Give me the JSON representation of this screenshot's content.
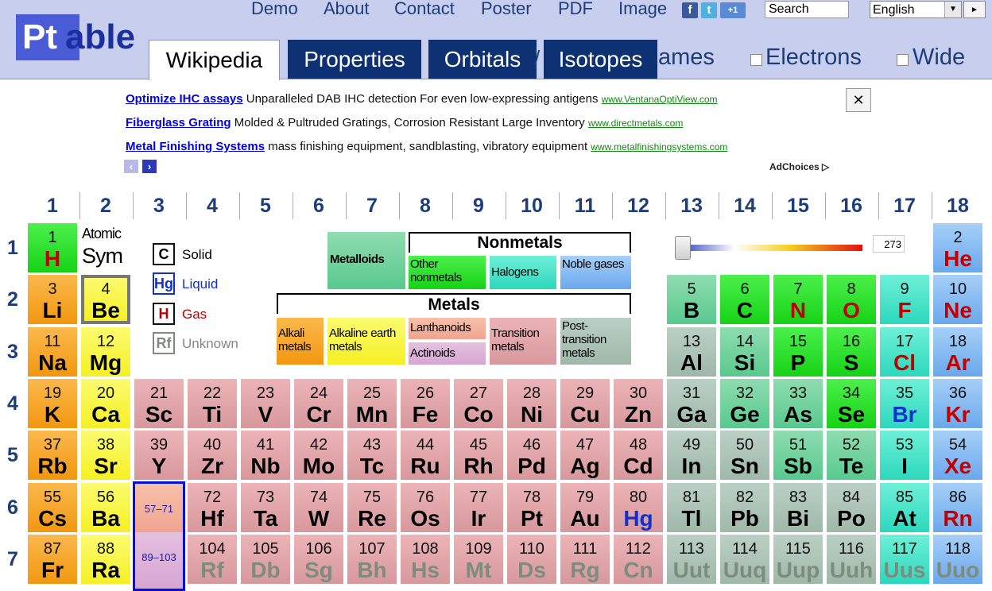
{
  "header": {
    "logo_pt": "Pt",
    "logo_able": "able",
    "nav": [
      "Demo",
      "About",
      "Contact",
      "Poster",
      "PDF",
      "Image"
    ],
    "social": [
      "f",
      "t",
      "+1"
    ],
    "search_value": "Search",
    "language": "English",
    "go_icon": "►"
  },
  "tabs": {
    "wikipedia": "Wikipedia",
    "properties": "Properties",
    "orbitals": "Orbitals",
    "isotopes": "Isotopes",
    "names_partial": "ames",
    "slash": "/",
    "electrons": "Electrons",
    "wide": "Wide"
  },
  "ads": [
    {
      "title": "Optimize IHC assays",
      "text": "Unparalleled DAB IHC detection For even low-expressing antigens",
      "url": "www.VentanaOptiView.com"
    },
    {
      "title": "Fiberglass Grating",
      "text": "Molded & Pultruded Gratings, Corrosion Resistant Large Inventory",
      "url": "www.directmetals.com"
    },
    {
      "title": "Metal Finishing Systems",
      "text": "mass finishing equipment, sandblasting, vibratory equipment",
      "url": "www.metalfinishingsystems.com"
    }
  ],
  "ad_close": "✕",
  "ad_prev": "‹",
  "ad_next": "›",
  "adchoices": "AdChoices ▷",
  "groups": [
    "1",
    "2",
    "3",
    "4",
    "5",
    "6",
    "7",
    "8",
    "9",
    "10",
    "11",
    "12",
    "13",
    "14",
    "15",
    "16",
    "17",
    "18"
  ],
  "periods": [
    "1",
    "2",
    "3",
    "4",
    "5",
    "6",
    "7"
  ],
  "legend": {
    "atomic": "Atomic",
    "sym": "Sym",
    "solid_sym": "C",
    "solid": "Solid",
    "liquid_sym": "Hg",
    "liquid": "Liquid",
    "gas_sym": "H",
    "gas": "Gas",
    "unknown_sym": "Rf",
    "unknown": "Unknown"
  },
  "categories": {
    "metalloids": "Metalloids",
    "nonmetals": "Nonmetals",
    "other_nonmetals": "Other nonmetals",
    "halogens": "Halogens",
    "noble": "Noble gases",
    "metals": "Metals",
    "alkali": "Alkali metals",
    "alkaline_earth": "Alkaline earth metals",
    "lanthanoids": "Lanthanoids",
    "actinoids": "Actinoids",
    "transition": "Transition metals",
    "post_transition": "Post-transition metals"
  },
  "temperature": "273",
  "lanthanide_range": "57–71",
  "actinide_range": "89–103",
  "elements": [
    {
      "z": "1",
      "sym": "H",
      "g": 1,
      "p": 1,
      "cat": "other",
      "state": "gas"
    },
    {
      "z": "2",
      "sym": "He",
      "g": 18,
      "p": 1,
      "cat": "noble",
      "state": "gas"
    },
    {
      "z": "3",
      "sym": "Li",
      "g": 1,
      "p": 2,
      "cat": "alkali",
      "state": "solid"
    },
    {
      "z": "4",
      "sym": "Be",
      "g": 2,
      "p": 2,
      "cat": "earth",
      "state": "solid",
      "selected": true
    },
    {
      "z": "5",
      "sym": "B",
      "g": 13,
      "p": 2,
      "cat": "metalloid",
      "state": "solid"
    },
    {
      "z": "6",
      "sym": "C",
      "g": 14,
      "p": 2,
      "cat": "other",
      "state": "solid"
    },
    {
      "z": "7",
      "sym": "N",
      "g": 15,
      "p": 2,
      "cat": "other",
      "state": "gas"
    },
    {
      "z": "8",
      "sym": "O",
      "g": 16,
      "p": 2,
      "cat": "other",
      "state": "gas"
    },
    {
      "z": "9",
      "sym": "F",
      "g": 17,
      "p": 2,
      "cat": "halogen",
      "state": "gas"
    },
    {
      "z": "10",
      "sym": "Ne",
      "g": 18,
      "p": 2,
      "cat": "noble",
      "state": "gas"
    },
    {
      "z": "11",
      "sym": "Na",
      "g": 1,
      "p": 3,
      "cat": "alkali",
      "state": "solid"
    },
    {
      "z": "12",
      "sym": "Mg",
      "g": 2,
      "p": 3,
      "cat": "earth",
      "state": "solid"
    },
    {
      "z": "13",
      "sym": "Al",
      "g": 13,
      "p": 3,
      "cat": "post",
      "state": "solid"
    },
    {
      "z": "14",
      "sym": "Si",
      "g": 14,
      "p": 3,
      "cat": "metalloid",
      "state": "solid"
    },
    {
      "z": "15",
      "sym": "P",
      "g": 15,
      "p": 3,
      "cat": "other",
      "state": "solid"
    },
    {
      "z": "16",
      "sym": "S",
      "g": 16,
      "p": 3,
      "cat": "other",
      "state": "solid"
    },
    {
      "z": "17",
      "sym": "Cl",
      "g": 17,
      "p": 3,
      "cat": "halogen",
      "state": "gas"
    },
    {
      "z": "18",
      "sym": "Ar",
      "g": 18,
      "p": 3,
      "cat": "noble",
      "state": "gas"
    },
    {
      "z": "19",
      "sym": "K",
      "g": 1,
      "p": 4,
      "cat": "alkali",
      "state": "solid"
    },
    {
      "z": "20",
      "sym": "Ca",
      "g": 2,
      "p": 4,
      "cat": "earth",
      "state": "solid"
    },
    {
      "z": "21",
      "sym": "Sc",
      "g": 3,
      "p": 4,
      "cat": "trans",
      "state": "solid"
    },
    {
      "z": "22",
      "sym": "Ti",
      "g": 4,
      "p": 4,
      "cat": "trans",
      "state": "solid"
    },
    {
      "z": "23",
      "sym": "V",
      "g": 5,
      "p": 4,
      "cat": "trans",
      "state": "solid"
    },
    {
      "z": "24",
      "sym": "Cr",
      "g": 6,
      "p": 4,
      "cat": "trans",
      "state": "solid"
    },
    {
      "z": "25",
      "sym": "Mn",
      "g": 7,
      "p": 4,
      "cat": "trans",
      "state": "solid"
    },
    {
      "z": "26",
      "sym": "Fe",
      "g": 8,
      "p": 4,
      "cat": "trans",
      "state": "solid"
    },
    {
      "z": "27",
      "sym": "Co",
      "g": 9,
      "p": 4,
      "cat": "trans",
      "state": "solid"
    },
    {
      "z": "28",
      "sym": "Ni",
      "g": 10,
      "p": 4,
      "cat": "trans",
      "state": "solid"
    },
    {
      "z": "29",
      "sym": "Cu",
      "g": 11,
      "p": 4,
      "cat": "trans",
      "state": "solid"
    },
    {
      "z": "30",
      "sym": "Zn",
      "g": 12,
      "p": 4,
      "cat": "trans",
      "state": "solid"
    },
    {
      "z": "31",
      "sym": "Ga",
      "g": 13,
      "p": 4,
      "cat": "post",
      "state": "solid"
    },
    {
      "z": "32",
      "sym": "Ge",
      "g": 14,
      "p": 4,
      "cat": "metalloid",
      "state": "solid"
    },
    {
      "z": "33",
      "sym": "As",
      "g": 15,
      "p": 4,
      "cat": "metalloid",
      "state": "solid"
    },
    {
      "z": "34",
      "sym": "Se",
      "g": 16,
      "p": 4,
      "cat": "other",
      "state": "solid"
    },
    {
      "z": "35",
      "sym": "Br",
      "g": 17,
      "p": 4,
      "cat": "halogen",
      "state": "liquid"
    },
    {
      "z": "36",
      "sym": "Kr",
      "g": 18,
      "p": 4,
      "cat": "noble",
      "state": "gas"
    },
    {
      "z": "37",
      "sym": "Rb",
      "g": 1,
      "p": 5,
      "cat": "alkali",
      "state": "solid"
    },
    {
      "z": "38",
      "sym": "Sr",
      "g": 2,
      "p": 5,
      "cat": "earth",
      "state": "solid"
    },
    {
      "z": "39",
      "sym": "Y",
      "g": 3,
      "p": 5,
      "cat": "trans",
      "state": "solid"
    },
    {
      "z": "40",
      "sym": "Zr",
      "g": 4,
      "p": 5,
      "cat": "trans",
      "state": "solid"
    },
    {
      "z": "41",
      "sym": "Nb",
      "g": 5,
      "p": 5,
      "cat": "trans",
      "state": "solid"
    },
    {
      "z": "42",
      "sym": "Mo",
      "g": 6,
      "p": 5,
      "cat": "trans",
      "state": "solid"
    },
    {
      "z": "43",
      "sym": "Tc",
      "g": 7,
      "p": 5,
      "cat": "trans",
      "state": "solid"
    },
    {
      "z": "44",
      "sym": "Ru",
      "g": 8,
      "p": 5,
      "cat": "trans",
      "state": "solid"
    },
    {
      "z": "45",
      "sym": "Rh",
      "g": 9,
      "p": 5,
      "cat": "trans",
      "state": "solid"
    },
    {
      "z": "46",
      "sym": "Pd",
      "g": 10,
      "p": 5,
      "cat": "trans",
      "state": "solid"
    },
    {
      "z": "47",
      "sym": "Ag",
      "g": 11,
      "p": 5,
      "cat": "trans",
      "state": "solid"
    },
    {
      "z": "48",
      "sym": "Cd",
      "g": 12,
      "p": 5,
      "cat": "trans",
      "state": "solid"
    },
    {
      "z": "49",
      "sym": "In",
      "g": 13,
      "p": 5,
      "cat": "post",
      "state": "solid"
    },
    {
      "z": "50",
      "sym": "Sn",
      "g": 14,
      "p": 5,
      "cat": "post",
      "state": "solid"
    },
    {
      "z": "51",
      "sym": "Sb",
      "g": 15,
      "p": 5,
      "cat": "metalloid",
      "state": "solid"
    },
    {
      "z": "52",
      "sym": "Te",
      "g": 16,
      "p": 5,
      "cat": "metalloid",
      "state": "solid"
    },
    {
      "z": "53",
      "sym": "I",
      "g": 17,
      "p": 5,
      "cat": "halogen",
      "state": "solid"
    },
    {
      "z": "54",
      "sym": "Xe",
      "g": 18,
      "p": 5,
      "cat": "noble",
      "state": "gas"
    },
    {
      "z": "55",
      "sym": "Cs",
      "g": 1,
      "p": 6,
      "cat": "alkali",
      "state": "solid"
    },
    {
      "z": "56",
      "sym": "Ba",
      "g": 2,
      "p": 6,
      "cat": "earth",
      "state": "solid"
    },
    {
      "z": "72",
      "sym": "Hf",
      "g": 4,
      "p": 6,
      "cat": "trans",
      "state": "solid"
    },
    {
      "z": "73",
      "sym": "Ta",
      "g": 5,
      "p": 6,
      "cat": "trans",
      "state": "solid"
    },
    {
      "z": "74",
      "sym": "W",
      "g": 6,
      "p": 6,
      "cat": "trans",
      "state": "solid"
    },
    {
      "z": "75",
      "sym": "Re",
      "g": 7,
      "p": 6,
      "cat": "trans",
      "state": "solid"
    },
    {
      "z": "76",
      "sym": "Os",
      "g": 8,
      "p": 6,
      "cat": "trans",
      "state": "solid"
    },
    {
      "z": "77",
      "sym": "Ir",
      "g": 9,
      "p": 6,
      "cat": "trans",
      "state": "solid"
    },
    {
      "z": "78",
      "sym": "Pt",
      "g": 10,
      "p": 6,
      "cat": "trans",
      "state": "solid"
    },
    {
      "z": "79",
      "sym": "Au",
      "g": 11,
      "p": 6,
      "cat": "trans",
      "state": "solid"
    },
    {
      "z": "80",
      "sym": "Hg",
      "g": 12,
      "p": 6,
      "cat": "trans",
      "state": "liquid"
    },
    {
      "z": "81",
      "sym": "Tl",
      "g": 13,
      "p": 6,
      "cat": "post",
      "state": "solid"
    },
    {
      "z": "82",
      "sym": "Pb",
      "g": 14,
      "p": 6,
      "cat": "post",
      "state": "solid"
    },
    {
      "z": "83",
      "sym": "Bi",
      "g": 15,
      "p": 6,
      "cat": "post",
      "state": "solid"
    },
    {
      "z": "84",
      "sym": "Po",
      "g": 16,
      "p": 6,
      "cat": "post",
      "state": "solid"
    },
    {
      "z": "85",
      "sym": "At",
      "g": 17,
      "p": 6,
      "cat": "halogen",
      "state": "solid"
    },
    {
      "z": "86",
      "sym": "Rn",
      "g": 18,
      "p": 6,
      "cat": "noble",
      "state": "gas"
    },
    {
      "z": "87",
      "sym": "Fr",
      "g": 1,
      "p": 7,
      "cat": "alkali",
      "state": "solid"
    },
    {
      "z": "88",
      "sym": "Ra",
      "g": 2,
      "p": 7,
      "cat": "earth",
      "state": "solid"
    },
    {
      "z": "104",
      "sym": "Rf",
      "g": 4,
      "p": 7,
      "cat": "trans",
      "state": "unknown"
    },
    {
      "z": "105",
      "sym": "Db",
      "g": 5,
      "p": 7,
      "cat": "trans",
      "state": "unknown"
    },
    {
      "z": "106",
      "sym": "Sg",
      "g": 6,
      "p": 7,
      "cat": "trans",
      "state": "unknown"
    },
    {
      "z": "107",
      "sym": "Bh",
      "g": 7,
      "p": 7,
      "cat": "trans",
      "state": "unknown"
    },
    {
      "z": "108",
      "sym": "Hs",
      "g": 8,
      "p": 7,
      "cat": "trans",
      "state": "unknown"
    },
    {
      "z": "109",
      "sym": "Mt",
      "g": 9,
      "p": 7,
      "cat": "trans",
      "state": "unknown"
    },
    {
      "z": "110",
      "sym": "Ds",
      "g": 10,
      "p": 7,
      "cat": "trans",
      "state": "unknown"
    },
    {
      "z": "111",
      "sym": "Rg",
      "g": 11,
      "p": 7,
      "cat": "trans",
      "state": "unknown"
    },
    {
      "z": "112",
      "sym": "Cn",
      "g": 12,
      "p": 7,
      "cat": "trans",
      "state": "unknown"
    },
    {
      "z": "113",
      "sym": "Uut",
      "g": 13,
      "p": 7,
      "cat": "post",
      "state": "unknown"
    },
    {
      "z": "114",
      "sym": "Uuq",
      "g": 14,
      "p": 7,
      "cat": "post",
      "state": "unknown"
    },
    {
      "z": "115",
      "sym": "Uup",
      "g": 15,
      "p": 7,
      "cat": "post",
      "state": "unknown"
    },
    {
      "z": "116",
      "sym": "Uuh",
      "g": 16,
      "p": 7,
      "cat": "post",
      "state": "unknown"
    },
    {
      "z": "117",
      "sym": "Uus",
      "g": 17,
      "p": 7,
      "cat": "halogen",
      "state": "unknown"
    },
    {
      "z": "118",
      "sym": "Uuo",
      "g": 18,
      "p": 7,
      "cat": "noble",
      "state": "unknown"
    }
  ]
}
